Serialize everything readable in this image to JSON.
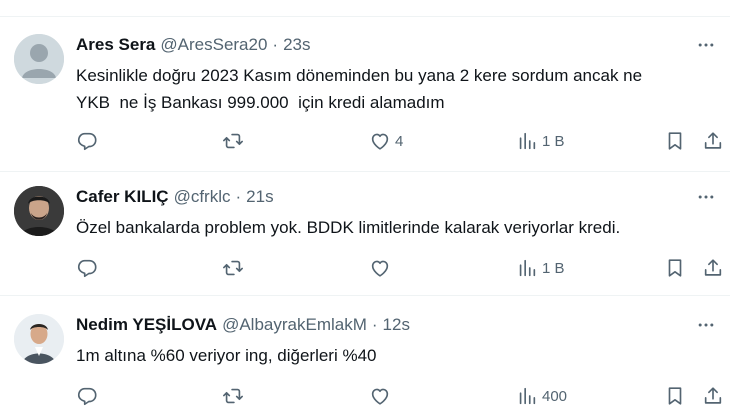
{
  "tweets": [
    {
      "name": "Ares Sera",
      "handle": "@AresSera20",
      "separator": "·",
      "time": "23s",
      "text": "Kesinlikle doğru 2023 Kasım döneminden bu yana 2 kere sordum ancak ne\nYKB  ne İş Bankası 999.000  için kredi alamadım",
      "likes": "4",
      "views": "1 B"
    },
    {
      "name": "Cafer KILIÇ",
      "handle": "@cfrklc",
      "separator": "·",
      "time": "21s",
      "text": "Özel bankalarda problem yok. BDDK limitlerinde kalarak veriyorlar kredi.",
      "likes": "",
      "views": "1 B"
    },
    {
      "name": "Nedim YEŞİLOVA",
      "handle": "@AlbayrakEmlakM",
      "separator": "·",
      "time": "12s",
      "text": "1m altına %60 veriyor ing, diğerleri %40",
      "likes": "",
      "views": "400"
    }
  ],
  "icons": {
    "reply": "reply-icon",
    "retweet": "retweet-icon",
    "like": "heart-icon",
    "views": "views-icon",
    "bookmark": "bookmark-icon",
    "share": "share-icon",
    "more": "more-icon"
  },
  "colors": {
    "text": "#0f1419",
    "secondary": "#536471",
    "divider": "#eff3f4"
  }
}
